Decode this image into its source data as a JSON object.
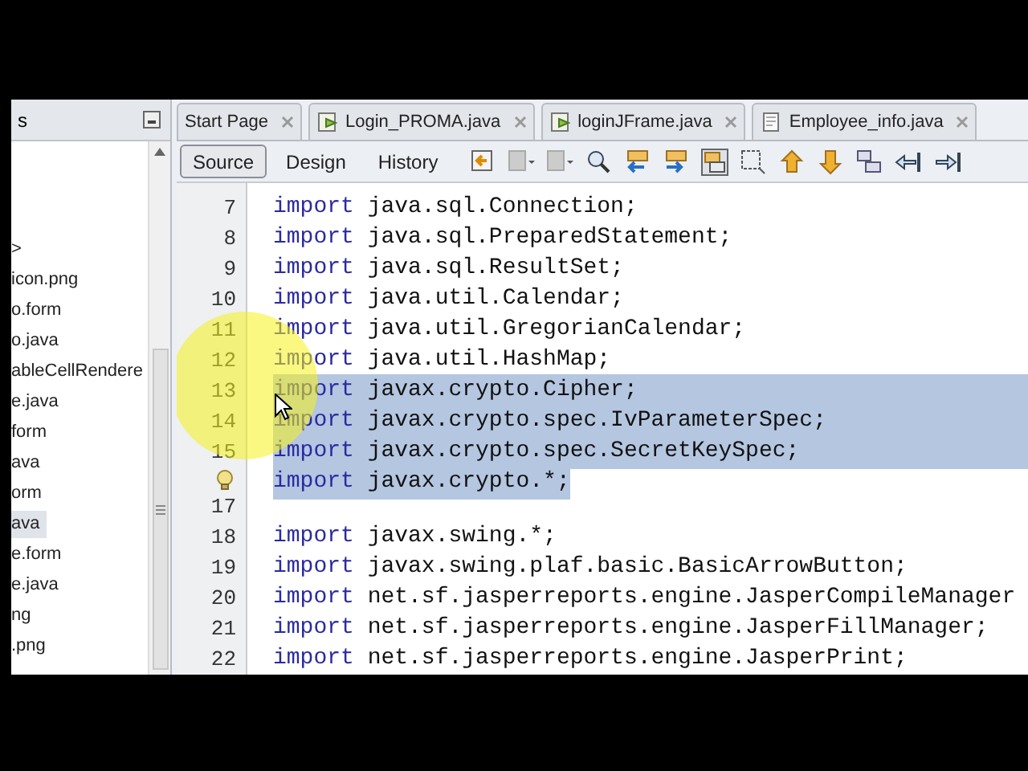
{
  "project_panel": {
    "title": "s",
    "items": [
      {
        "text": ">",
        "selected": false
      },
      {
        "text": "icon.png",
        "selected": false
      },
      {
        "text": "o.form",
        "selected": false
      },
      {
        "text": "o.java",
        "selected": false
      },
      {
        "text": "ableCellRendere",
        "selected": false
      },
      {
        "text": "e.java",
        "selected": false
      },
      {
        "text": "form",
        "selected": false
      },
      {
        "text": "ava",
        "selected": false
      },
      {
        "text": "orm",
        "selected": false
      },
      {
        "text": "ava",
        "selected": true
      },
      {
        "text": "e.form",
        "selected": false
      },
      {
        "text": "e.java",
        "selected": false
      },
      {
        "text": "ng",
        "selected": false
      },
      {
        "text": ".png",
        "selected": false
      }
    ]
  },
  "editor_tabs": [
    {
      "label": "Start Page",
      "kind": "page",
      "selected": false
    },
    {
      "label": "Login_PROMA.java",
      "kind": "form",
      "selected": false
    },
    {
      "label": "loginJFrame.java",
      "kind": "form",
      "selected": false
    },
    {
      "label": "Employee_info.java",
      "kind": "file",
      "selected": false
    }
  ],
  "view_buttons": [
    {
      "label": "Source",
      "selected": true
    },
    {
      "label": "Design",
      "selected": false
    },
    {
      "label": "History",
      "selected": false
    }
  ],
  "code_lines": [
    {
      "kind": "line",
      "number": "7",
      "keyword": "import",
      "code": "java.sql.Connection;",
      "selected": false
    },
    {
      "kind": "line",
      "number": "8",
      "keyword": "import",
      "code": "java.sql.PreparedStatement;",
      "selected": false
    },
    {
      "kind": "line",
      "number": "9",
      "keyword": "import",
      "code": "java.sql.ResultSet;",
      "selected": false
    },
    {
      "kind": "line",
      "number": "10",
      "keyword": "import",
      "code": "java.util.Calendar;",
      "selected": false
    },
    {
      "kind": "line",
      "number": "11",
      "keyword": "import",
      "code": "java.util.GregorianCalendar;",
      "selected": false
    },
    {
      "kind": "line",
      "number": "12",
      "keyword": "import",
      "code": "java.util.HashMap;",
      "selected": false
    },
    {
      "kind": "line",
      "number": "13",
      "keyword": "import",
      "code": "javax.crypto.Cipher;",
      "selected": true
    },
    {
      "kind": "line",
      "number": "14",
      "keyword": "import",
      "code": "javax.crypto.spec.IvParameterSpec;",
      "selected": true
    },
    {
      "kind": "line",
      "number": "15",
      "keyword": "import",
      "code": "javax.crypto.spec.SecretKeySpec;",
      "selected": true
    },
    {
      "kind": "hint",
      "keyword": "import",
      "code": "javax.crypto.*;",
      "selected": true
    },
    {
      "kind": "line",
      "number": "17"
    },
    {
      "kind": "line",
      "number": "18",
      "keyword": "import",
      "code": "javax.swing.*;",
      "selected": false
    },
    {
      "kind": "line",
      "number": "19",
      "keyword": "import",
      "code": "javax.swing.plaf.basic.BasicArrowButton;",
      "selected": false
    },
    {
      "kind": "line",
      "number": "20",
      "keyword": "import",
      "code": "net.sf.jasperreports.engine.JasperCompileManager",
      "selected": false
    },
    {
      "kind": "line",
      "number": "21",
      "keyword": "import",
      "code": "net.sf.jasperreports.engine.JasperFillManager;",
      "selected": false
    },
    {
      "kind": "line",
      "number": "22",
      "keyword": "import",
      "code": "net.sf.jasperreports.engine.JasperPrint;",
      "selected": false
    }
  ]
}
